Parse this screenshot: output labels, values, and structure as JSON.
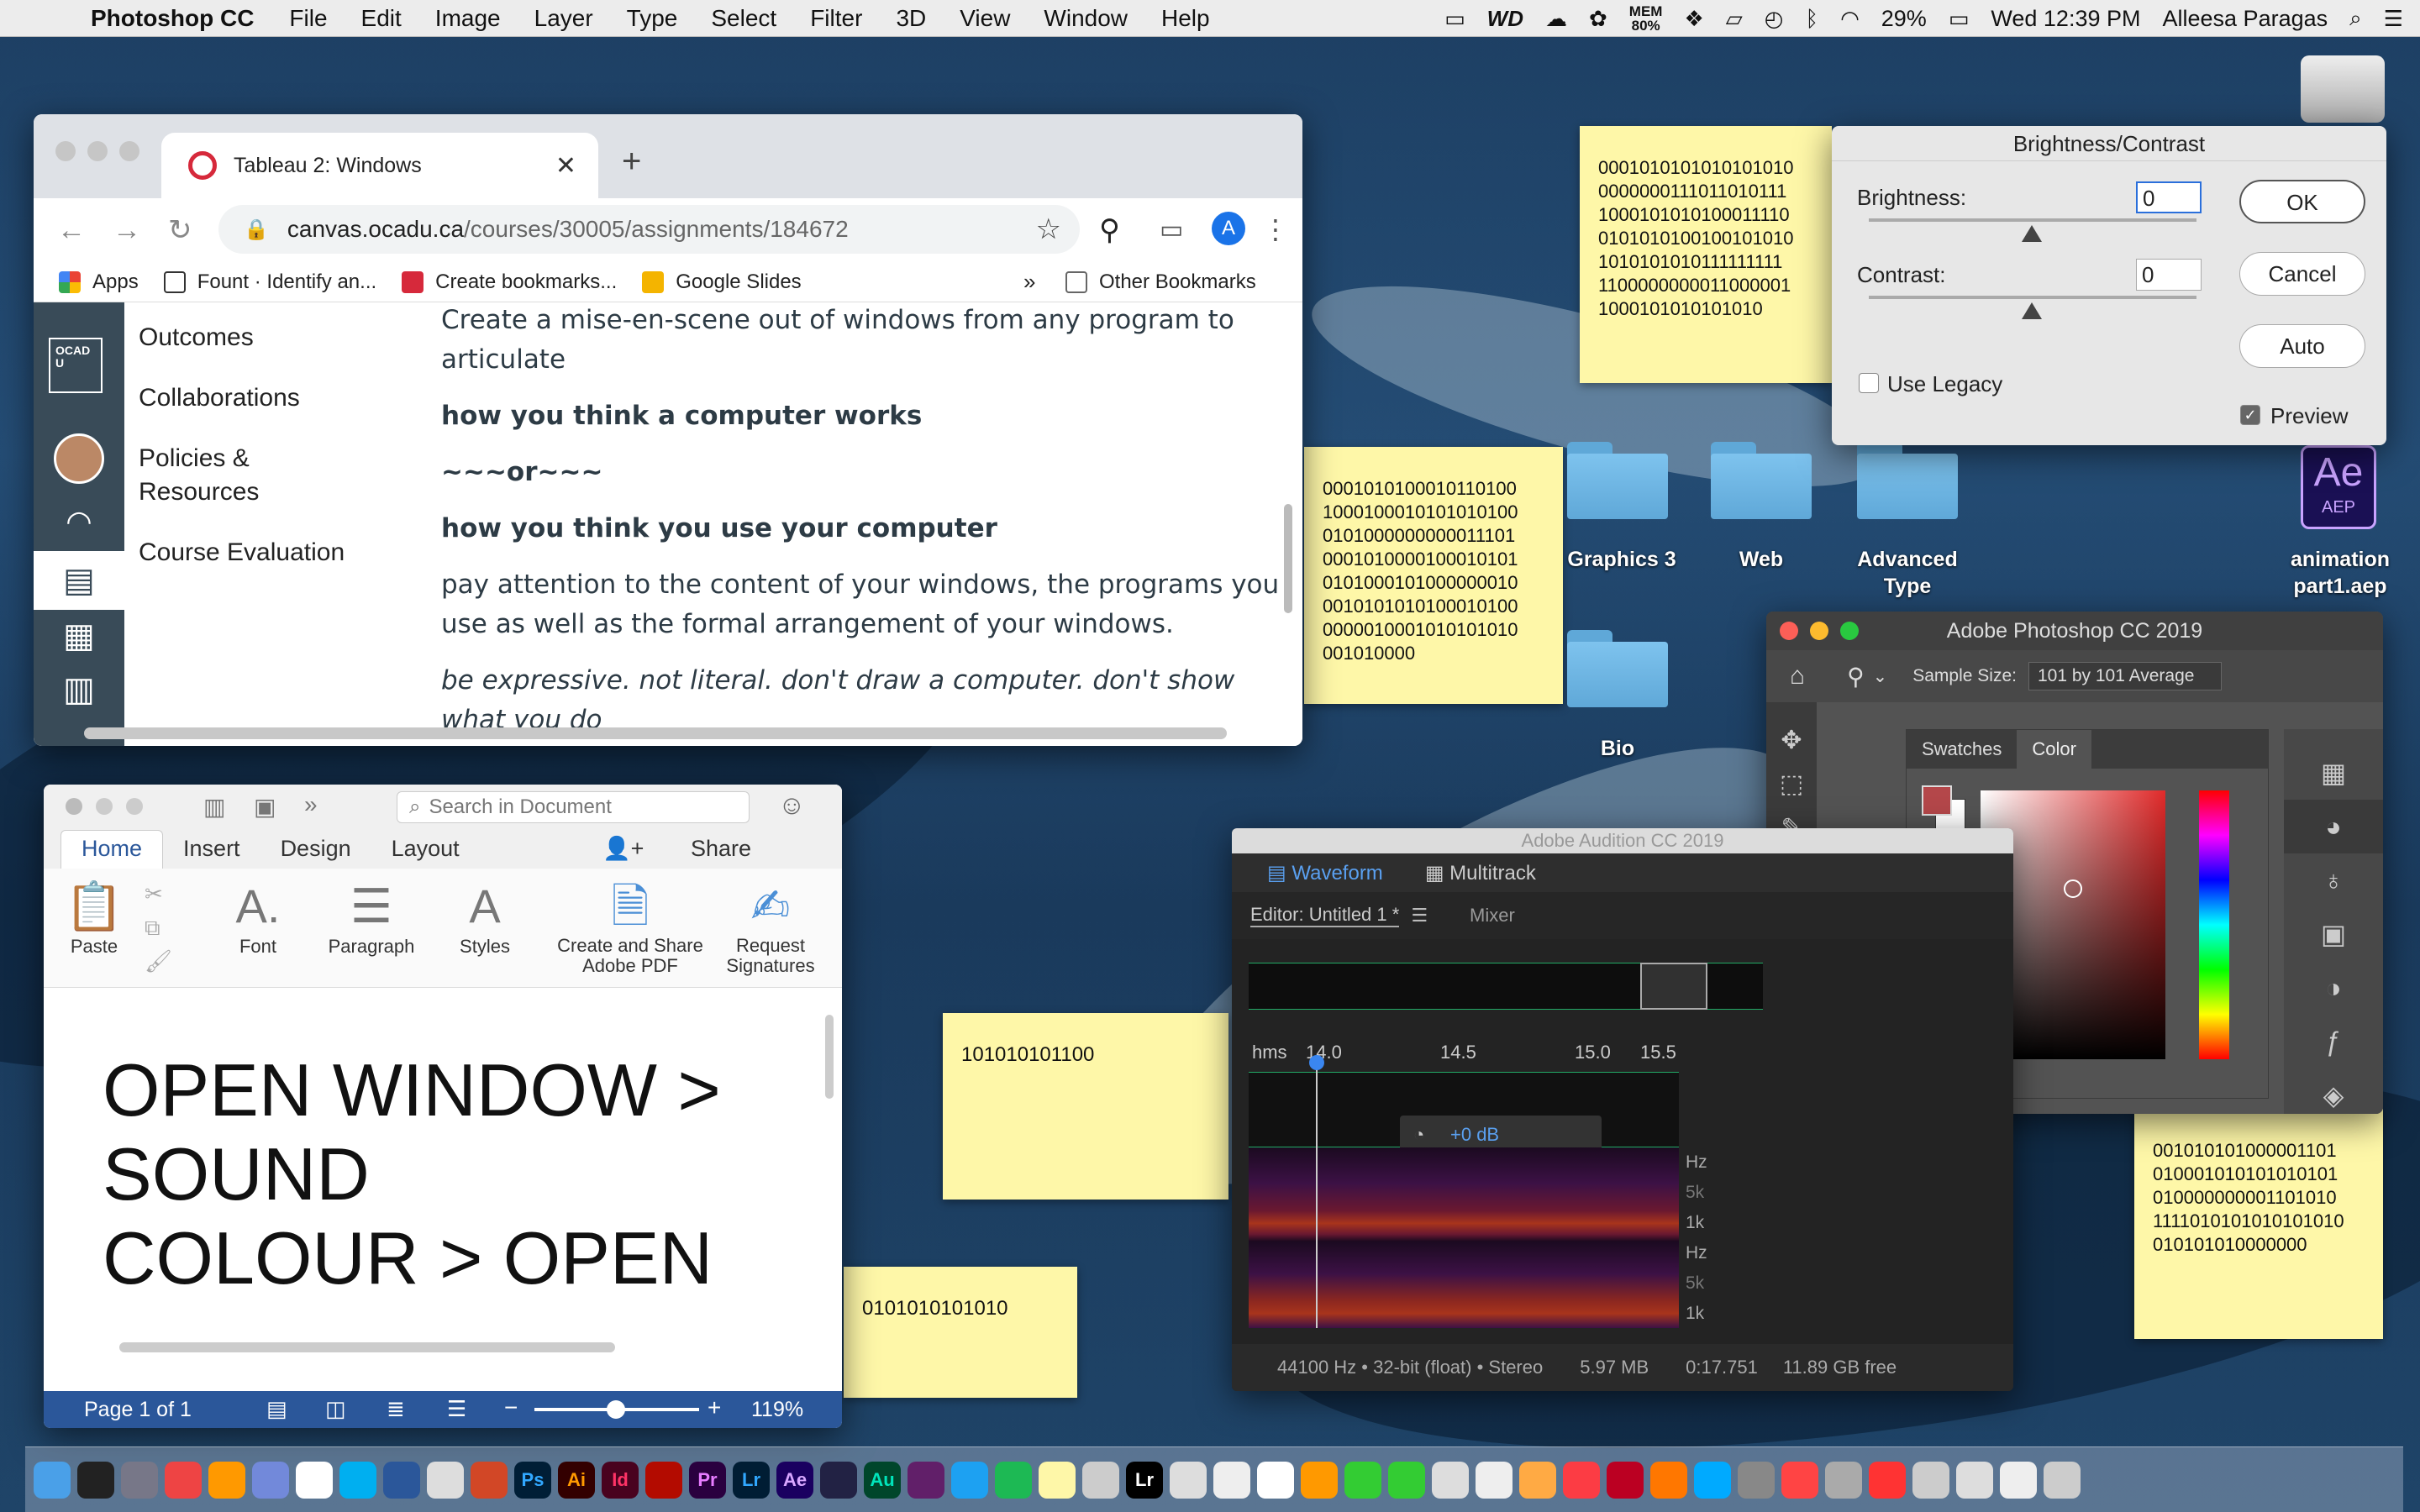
{
  "menubar": {
    "app": "Photoshop CC",
    "menus": [
      "File",
      "Edit",
      "Image",
      "Layer",
      "Type",
      "Select",
      "Filter",
      "3D",
      "View",
      "Window",
      "Help"
    ],
    "mem_label": "MEM",
    "mem_value": "80%",
    "battery": "29%",
    "clock": "Wed 12:39 PM",
    "user": "Alleesa Paragas"
  },
  "chrome": {
    "tab_title": "Tableau 2: Windows",
    "url_host": "canvas.ocadu.ca",
    "url_path": "/courses/30005/assignments/184672",
    "profile_initial": "A",
    "bookmarks": [
      "Apps",
      "Fount · Identify an...",
      "Create bookmarks...",
      "Google Slides"
    ],
    "more": "»",
    "other_bookmarks": "Other Bookmarks",
    "course_nav": [
      "Outcomes",
      "Collaborations",
      "Policies & Resources",
      "Course Evaluation"
    ],
    "logo_text": "OCAD U",
    "body": {
      "p1": "Create a mise-en-scene out of windows from any program to articulate",
      "p2": "how you think a computer works",
      "p3": "~~~or~~~",
      "p4": "how you think you use your computer",
      "p5": "pay attention to the content of your windows, the programs you use as well as the formal arrangement of your windows.",
      "p6": "be expressive. not literal. don't draw a computer. don't show what you do"
    }
  },
  "word": {
    "search_placeholder": "Search in Document",
    "tabs": [
      "Home",
      "Insert",
      "Design",
      "Layout"
    ],
    "share": "Share",
    "ribbon": [
      "Paste",
      "Font",
      "Paragraph",
      "Styles",
      "Create and Share Adobe PDF",
      "Request Signatures"
    ],
    "doc_lines": [
      "OPEN WINDOW >",
      "SOUND",
      "COLOUR > OPEN"
    ],
    "page_status": "Page 1 of 1",
    "zoom": "119%"
  },
  "stickies": {
    "s1": "0001010101010101010\n0000000111011010111\n1000101010100011110\n0101010100100101010\n1010101010111111111\n1100000000011000001\n1000101010101010",
    "s2": "0001010100010110100\n1000100010101010100\n0101000000000011101\n0001010000100010101\n0101000101000000010\n0010101010100010100\n0000010001010101010\n001010000",
    "s3": "101010101100",
    "s4": "0101010101010",
    "s5": "001010101000001101\n010001010101010101\n010000000001101010\n1111010101010101010\n010101010000000"
  },
  "brightness": {
    "title": "Brightness/Contrast",
    "brightness_label": "Brightness:",
    "brightness_value": "0",
    "contrast_label": "Contrast:",
    "contrast_value": "0",
    "ok": "OK",
    "cancel": "Cancel",
    "auto": "Auto",
    "use_legacy": "Use Legacy",
    "preview": "Preview"
  },
  "desktop": {
    "folders": [
      "Graphics 3",
      "Web",
      "Advanced Type",
      "Bio"
    ],
    "ae_file": "animation part1.aep",
    "ae_badge": "Ae",
    "ae_sub": "AEP"
  },
  "photoshop": {
    "title": "Adobe Photoshop CC 2019",
    "sample_size_label": "Sample Size:",
    "sample_size_value": "101 by 101 Average",
    "tabs": [
      "Swatches",
      "Color"
    ],
    "colors": {
      "foreground": "#b4474a",
      "spectrum_top": "#e02a2a"
    }
  },
  "audition": {
    "title": "Adobe Audition CC 2019",
    "tabs": [
      "Waveform",
      "Multitrack"
    ],
    "editor": "Editor: Untitled 1 *",
    "mixer": "Mixer",
    "ruler": [
      "hms",
      "14.0",
      "14.5",
      "15.0",
      "15.5"
    ],
    "hud": "+0 dB",
    "freq": [
      "Hz",
      "5k",
      "1k",
      "Hz",
      "5k",
      "1k"
    ],
    "status": [
      "44100 Hz • 32-bit (float) • Stereo",
      "5.97 MB",
      "0:17.751",
      "11.89 GB free"
    ]
  },
  "dock": {
    "labels": [
      "Ps",
      "Ai",
      "Id",
      "Pr",
      "Lr",
      "Ae",
      "Au",
      "Lr"
    ]
  }
}
